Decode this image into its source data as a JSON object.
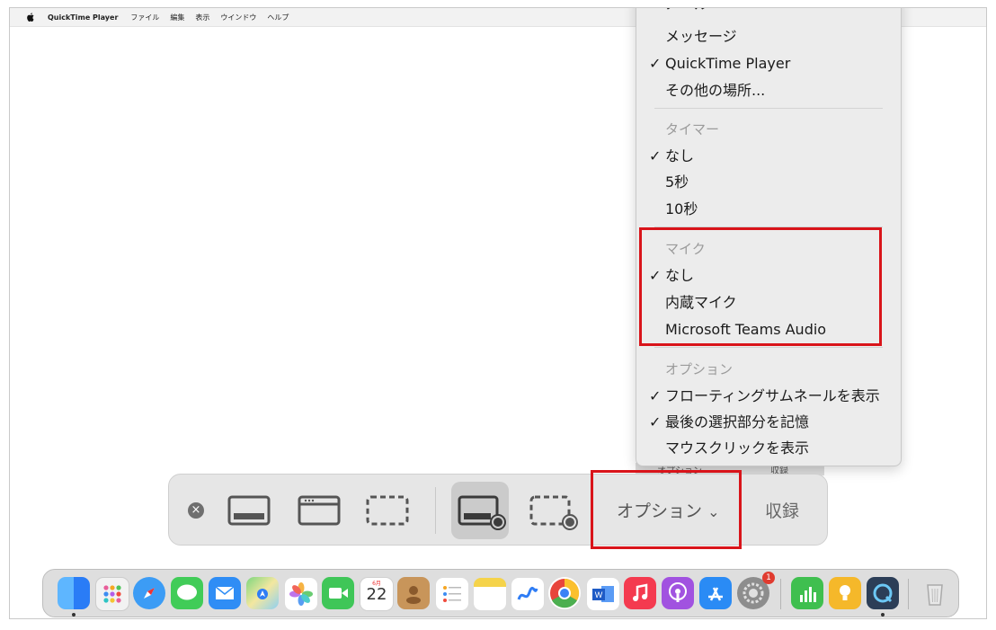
{
  "menubar": {
    "app_name": "QuickTime Player",
    "items": [
      "ファイル",
      "編集",
      "表示",
      "ウインドウ",
      "ヘルプ"
    ]
  },
  "dropdown": {
    "partial_top": "メール",
    "items": [
      {
        "label": "メッセージ",
        "checked": false,
        "header": false
      },
      {
        "label": "QuickTime Player",
        "checked": true,
        "header": false
      },
      {
        "label": "その他の場所...",
        "checked": false,
        "header": false
      },
      {
        "label": "タイマー",
        "checked": false,
        "header": true
      },
      {
        "label": "なし",
        "checked": true,
        "header": false
      },
      {
        "label": "5秒",
        "checked": false,
        "header": false
      },
      {
        "label": "10秒",
        "checked": false,
        "header": false
      },
      {
        "label": "マイク",
        "checked": false,
        "header": true
      },
      {
        "label": "なし",
        "checked": true,
        "header": false
      },
      {
        "label": "内蔵マイク",
        "checked": false,
        "header": false
      },
      {
        "label": "Microsoft Teams Audio",
        "checked": false,
        "header": false
      },
      {
        "label": "オプション",
        "checked": false,
        "header": true
      },
      {
        "label": "フローティングサムネールを表示",
        "checked": true,
        "header": false
      },
      {
        "label": "最後の選択部分を記憶",
        "checked": true,
        "header": false
      },
      {
        "label": "マウスクリックを表示",
        "checked": false,
        "header": false
      }
    ],
    "check_glyph": "✓"
  },
  "toolbar": {
    "close_glyph": "×",
    "options_label": "オプション",
    "options_chevron": "⌄",
    "record_label": "収録",
    "peek_left": "オプション",
    "peek_right": "収録"
  },
  "dock": {
    "calendar_month": "6月",
    "calendar_day": "22",
    "settings_badge": "1"
  },
  "colors": {
    "highlight_red": "#d9141a"
  }
}
